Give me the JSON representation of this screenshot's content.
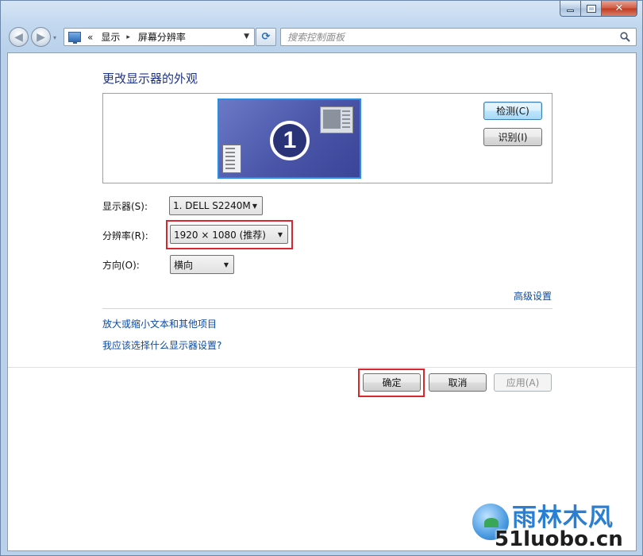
{
  "window": {
    "caption": {
      "min": "—",
      "max": "□",
      "close": "✕"
    }
  },
  "nav": {
    "back_glyph": "◀",
    "forward_glyph": "▶",
    "history_glyph": "▾"
  },
  "address": {
    "chevron": "«",
    "segments": [
      "显示",
      "屏幕分辨率"
    ],
    "separator": "▸",
    "dropdown_glyph": "▼",
    "refresh_glyph": "⟳"
  },
  "search": {
    "placeholder": "搜索控制面板"
  },
  "page": {
    "title": "更改显示器的外观"
  },
  "preview": {
    "monitor_number": "1",
    "detect_button": "检测(C)",
    "identify_button": "识别(I)"
  },
  "fields": {
    "display_label": "显示器(S):",
    "display_value": "1. DELL S2240M",
    "resolution_label": "分辨率(R):",
    "resolution_value": "1920 × 1080 (推荐)",
    "orientation_label": "方向(O):",
    "orientation_value": "横向",
    "combo_arrow": "▼"
  },
  "links": {
    "advanced": "高级设置",
    "enlarge_text": "放大或缩小文本和其他项目",
    "which_settings": "我应该选择什么显示器设置?"
  },
  "actions": {
    "ok": "确定",
    "cancel": "取消",
    "apply": "应用(A)"
  },
  "watermark": {
    "top": "雨林木风",
    "bottom": "51luobo.cn"
  },
  "colors": {
    "highlight_border": "#d9262f",
    "link": "#0b4aa3",
    "title": "#1e3287"
  }
}
